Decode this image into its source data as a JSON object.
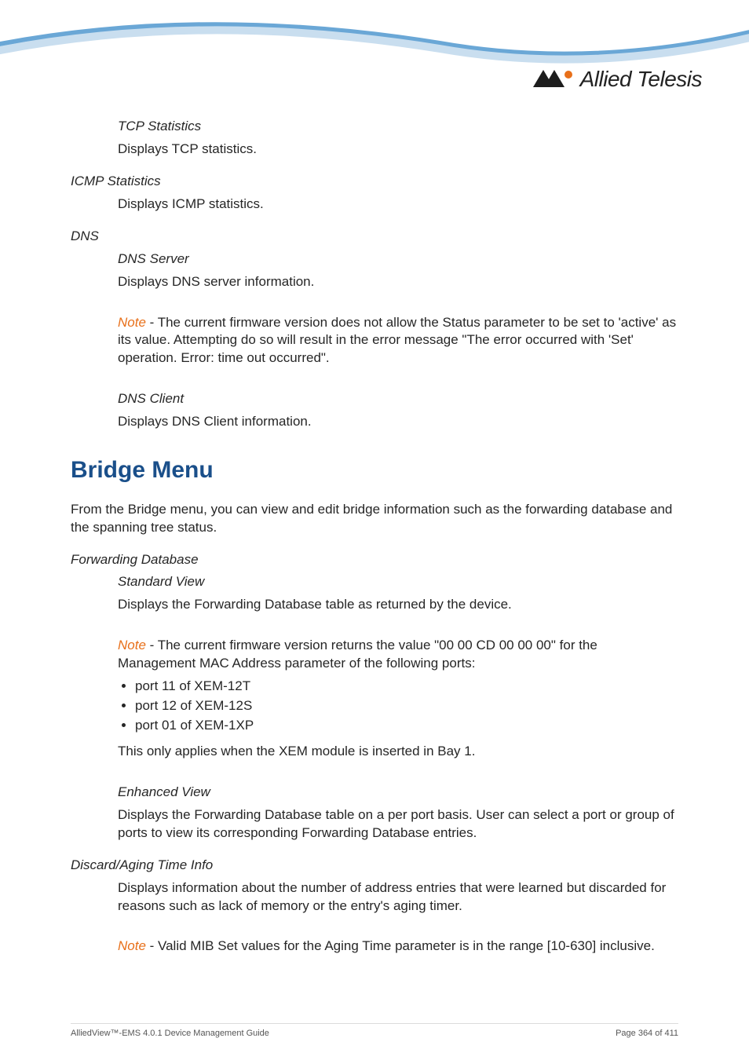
{
  "header": {
    "logo_text": "Allied Telesis"
  },
  "sections": {
    "tcp_stats_title": "TCP Statistics",
    "tcp_stats_body": "Displays TCP statistics.",
    "icmp_title": "ICMP Statistics",
    "icmp_body": "Displays ICMP statistics.",
    "dns_title": "DNS",
    "dns_server_title": "DNS Server",
    "dns_server_body": "Displays DNS server information.",
    "dns_note_label": "Note",
    "dns_note_body": " - The current firmware version does not allow the Status parameter to be set to 'active' as its value. Attempting do so will result in the error message \"The error occurred with 'Set' operation. Error: time out occurred\".",
    "dns_client_title": "DNS Client",
    "dns_client_body": "Displays DNS Client information.",
    "bridge_heading": "Bridge Menu",
    "bridge_intro": "From the Bridge menu, you can view and edit bridge information such as the forwarding database and the spanning tree status.",
    "fdb_title": "Forwarding Database",
    "fdb_std_title": "Standard View",
    "fdb_std_body": "Displays the Forwarding Database table as returned by the device.",
    "fdb_note_label": "Note",
    "fdb_note_body": " - The current firmware version returns the value \"00 00 CD 00 00 00\" for the Management MAC Address parameter of the following ports:",
    "fdb_bullets": [
      "port 11 of XEM-12T",
      "port 12 of XEM-12S",
      "port 01 of XEM-1XP"
    ],
    "fdb_after_bullets": "This only applies when the XEM module is inserted in Bay 1.",
    "fdb_enh_title": "Enhanced View",
    "fdb_enh_body": "Displays the Forwarding Database table on a per port basis. User can select a port or group of ports to view its corresponding Forwarding Database entries.",
    "discard_title": "Discard/Aging Time Info",
    "discard_body": "Displays information about the number of address entries that were learned but discarded for reasons such as lack of memory or the entry's aging timer.",
    "discard_note_label": "Note",
    "discard_note_body": " - Valid MIB Set values for the Aging Time parameter is in the range [10-630] inclusive."
  },
  "footer": {
    "left": "AlliedView™-EMS 4.0.1 Device Management Guide",
    "right": "Page 364 of 411"
  }
}
